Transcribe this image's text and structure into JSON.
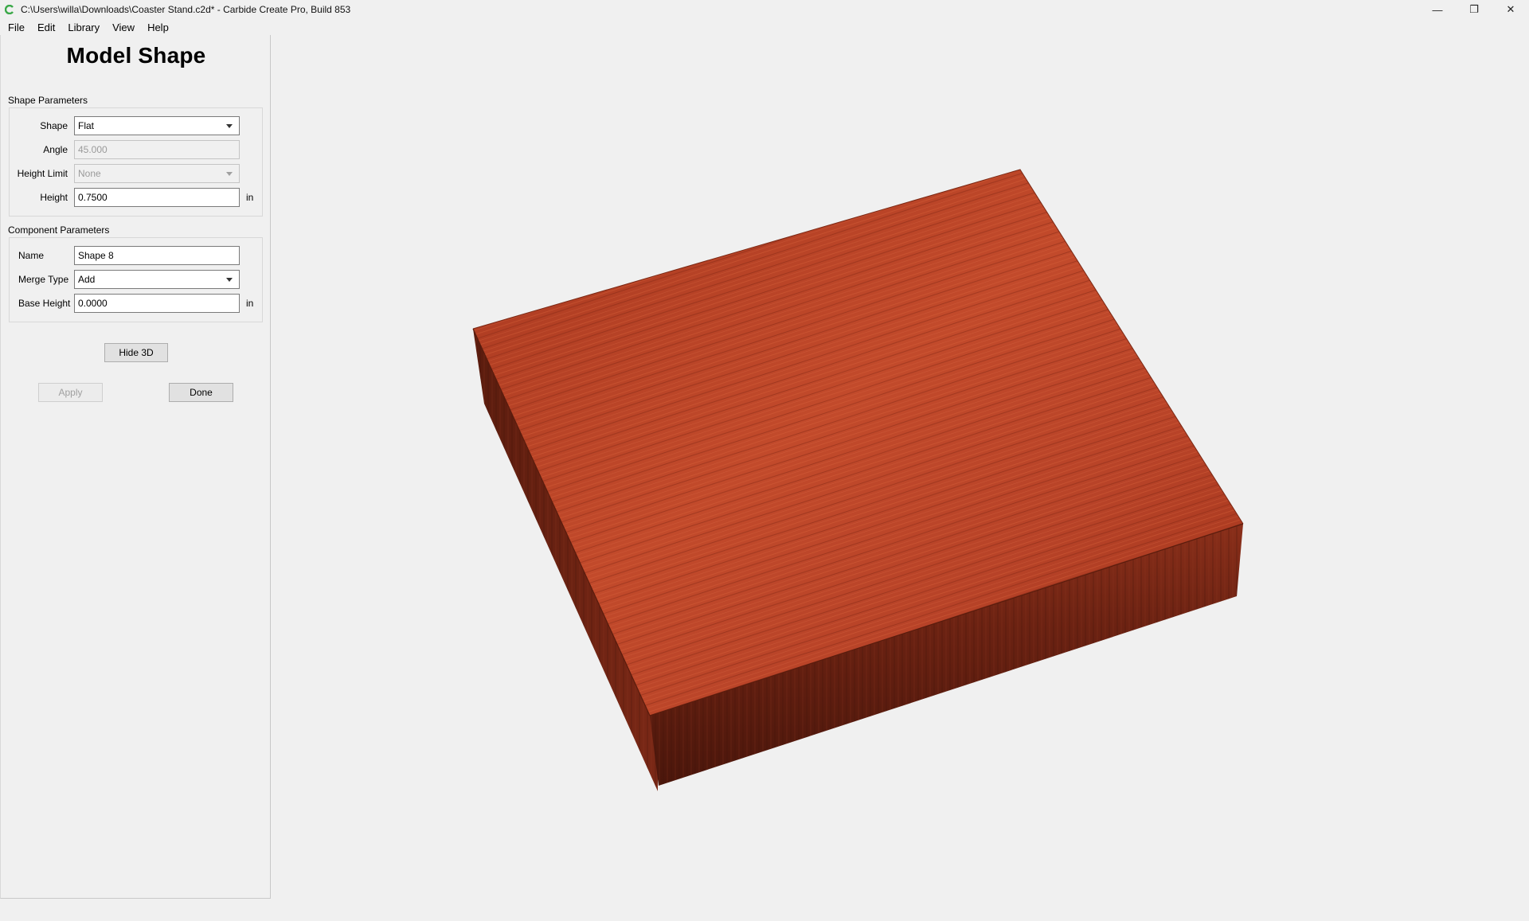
{
  "window": {
    "title": "C:\\Users\\willa\\Downloads\\Coaster Stand.c2d* - Carbide Create Pro, Build 853",
    "minimize": "—",
    "restore": "❐",
    "close": "✕"
  },
  "menu": {
    "file": "File",
    "edit": "Edit",
    "library": "Library",
    "view": "View",
    "help": "Help"
  },
  "panel": {
    "title": "Model Shape",
    "shape_params": {
      "label": "Shape Parameters",
      "shape_label": "Shape",
      "shape_value": "Flat",
      "angle_label": "Angle",
      "angle_value": "45.000",
      "height_limit_label": "Height Limit",
      "height_limit_value": "None",
      "height_label": "Height",
      "height_value": "0.7500",
      "height_unit": "in"
    },
    "component_params": {
      "label": "Component Parameters",
      "name_label": "Name",
      "name_value": "Shape 8",
      "merge_type_label": "Merge Type",
      "merge_type_value": "Add",
      "base_height_label": "Base Height",
      "base_height_value": "0.0000",
      "base_height_unit": "in"
    },
    "hide3d": "Hide 3D",
    "apply": "Apply",
    "done": "Done"
  },
  "colors": {
    "wood_top": "#b8462a",
    "wood_side": "#6e2414",
    "app_icon": "#3aa848"
  }
}
